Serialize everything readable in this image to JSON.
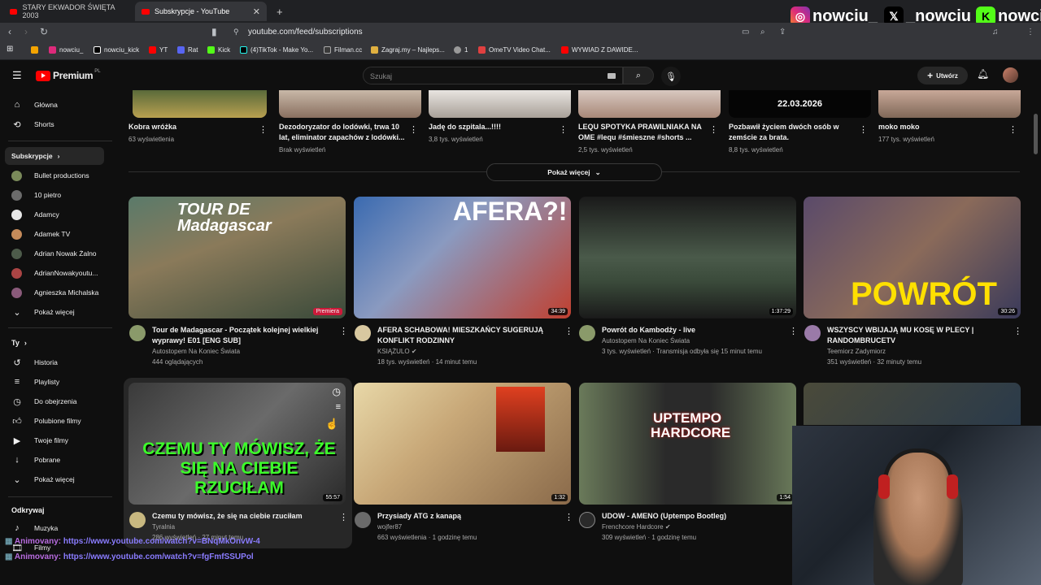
{
  "browser": {
    "tabs": [
      {
        "label": "STARY EKWADOR ŚWIĘTA 2003"
      },
      {
        "label": "Subskrypcje - YouTube"
      }
    ],
    "url": "youtube.com/feed/subscriptions",
    "bookmarks": [
      "nowciu_",
      "nowciu_kick",
      "YT",
      "Rat",
      "Kick",
      "(4)TikTok - Make Yo...",
      "Filman.cc",
      "Zagraj.my – Najleps...",
      "1",
      "OmeTV Video Chat...",
      "WYWIAD Z DAWIDE..."
    ]
  },
  "social_overlay": {
    "handles": [
      "nowciu_",
      "_nowciu",
      "nowciu"
    ]
  },
  "yt": {
    "logo": "Premium",
    "logo_sup": "PL",
    "search_placeholder": "Szukaj",
    "create_label": "Utwórz"
  },
  "sidebar": {
    "main": [
      {
        "label": "Główna",
        "icon": "home-icon"
      },
      {
        "label": "Shorts",
        "icon": "shorts-icon"
      }
    ],
    "subscriptions_header": "Subskrypcje",
    "channels": [
      {
        "label": "Bullet productions",
        "color": "#7a8a5a"
      },
      {
        "label": "10 pietro",
        "color": "#6b6b6b"
      },
      {
        "label": "Adamcy",
        "color": "#e8e8e8"
      },
      {
        "label": "Adamek TV",
        "color": "#c58b5a"
      },
      {
        "label": "Adrian Nowak Żalno",
        "color": "#4d5b4a"
      },
      {
        "label": "AdrianNowakyoutu...",
        "color": "#aa4444"
      },
      {
        "label": "Agnieszka Michalska",
        "color": "#8a5a7a"
      }
    ],
    "show_more_1": "Pokaż więcej",
    "you_header": "Ty",
    "you_items": [
      {
        "label": "Historia",
        "icon": "history-icon"
      },
      {
        "label": "Playlisty",
        "icon": "playlist-icon"
      },
      {
        "label": "Do obejrzenia",
        "icon": "clock-icon"
      },
      {
        "label": "Polubione filmy",
        "icon": "thumb-up-icon"
      },
      {
        "label": "Twoje filmy",
        "icon": "video-icon"
      },
      {
        "label": "Pobrane",
        "icon": "download-icon"
      }
    ],
    "show_more_2": "Pokaż więcej",
    "explore_header": "Odkrywaj",
    "explore_items": [
      {
        "label": "Muzyka",
        "icon": "music-icon"
      },
      {
        "label": "Filmy",
        "icon": "film-icon"
      }
    ]
  },
  "shorts_row": [
    {
      "title": "Kobra wróżka",
      "meta": "63 wyświetlenia"
    },
    {
      "title": "Dezodoryzator do lodówki, trwa 10 lat, eliminator zapachów z lodówki...",
      "meta": "Brak wyświetleń"
    },
    {
      "title": "Jadę do szpitala...!!!!",
      "meta": "3,8 tys. wyświetleń"
    },
    {
      "title": "LEQU SPOTYKA PRAWILNIAKA NA OME #lequ #śmieszne #shorts ...",
      "meta": "2,5 tys. wyświetleń"
    },
    {
      "title": "Pozbawił życiem dwóch osób w zemście za brata.",
      "meta": "8,8 tys. wyświetleń",
      "thumb_text": "22.03.2026"
    },
    {
      "title": "moko moko",
      "meta": "177 tys. wyświetleń"
    }
  ],
  "show_more_videos": "Pokaż więcej",
  "videos_row1": [
    {
      "title": "Tour de Madagascar - Początek kolejnej wielkiej wyprawy! E01 [ENG SUB]",
      "channel": "Autostopem Na Koniec Świata",
      "meta": "444 oglądających",
      "badge": "Premiera",
      "thumb_text": "TOUR DE Madagascar"
    },
    {
      "title": "AFERA SCHABOWA! MIESZKAŃCY SUGERUJĄ KONFLIKT RODZINNY",
      "channel": "KSIĄŻULO",
      "meta": "18 tys. wyświetleń · 14 minut temu",
      "duration": "34:39",
      "thumb_text": "AFERA?!"
    },
    {
      "title": "Powrót do Kambodży - live",
      "channel": "Autostopem Na Koniec Świata",
      "meta": "3 tys. wyświetleń · Transmisja odbyła się 15 minut temu",
      "duration": "1:37:29"
    },
    {
      "title": "WSZYSCY WBIJAJĄ MU KOSĘ W PLECY | RANDOMBRUCETV",
      "channel": "Teemiorz Zadymiorz",
      "meta": "351 wyświetleń · 32 minuty temu",
      "duration": "30:26",
      "thumb_text": "POWRÓT"
    }
  ],
  "videos_row2": [
    {
      "title": "Czemu ty mówisz, że się na ciebie rzuciłam",
      "channel": "Tyralnia",
      "meta": "286 wyświetleń · 27 minut temu",
      "duration": "55:57",
      "thumb_text": "CZEMU TY MÓWISZ, ŻE SIĘ NA CIEBIE RZUCIŁAM"
    },
    {
      "title": "Przysiady ATG z kanapą",
      "channel": "wojfer87",
      "meta": "663 wyświetlenia · 1 godzinę temu",
      "duration": "1:32"
    },
    {
      "title": "UDOW - AMENO (Uptempo Bootleg)",
      "channel": "Frenchcore Hardcore",
      "meta": "309 wyświetleń · 1 godzinę temu",
      "duration": "1:54",
      "thumb_text": "UPTEMPO HARDCORE"
    }
  ],
  "chat": [
    {
      "user": "Animovany",
      "text": "https://www.youtube.com/watch?v=BNqMkOnvW-4"
    },
    {
      "user": "Animovany",
      "text": "https://www.youtube.com/watch?v=fgFmfSSUPol"
    }
  ]
}
